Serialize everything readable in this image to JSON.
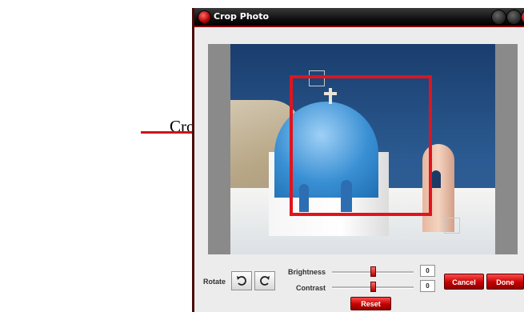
{
  "annotation": {
    "label": "Crop box"
  },
  "window": {
    "title": "Crop Photo"
  },
  "controls": {
    "rotate_label": "Rotate",
    "rotate_left_icon": "rotate-ccw-icon",
    "rotate_right_icon": "rotate-cw-icon",
    "brightness": {
      "label": "Brightness",
      "value": "0",
      "level": 0.5
    },
    "contrast": {
      "label": "Contrast",
      "value": "0",
      "level": 0.5
    },
    "reset_label": "Reset",
    "cancel_label": "Cancel",
    "done_label": "Done"
  },
  "colors": {
    "accent": "#d0111b",
    "titlebar": "#111111",
    "window_bg": "#ececec"
  }
}
